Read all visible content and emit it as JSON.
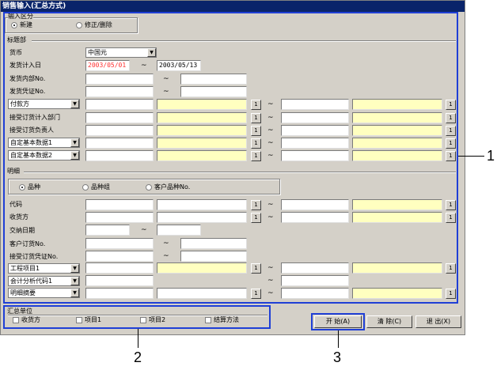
{
  "window": {
    "title": "销售输入(汇总方式)"
  },
  "input_type": {
    "legend": "输入区分",
    "options": [
      {
        "label": "新建",
        "selected": true
      },
      {
        "label": "修正/删除",
        "selected": false
      }
    ]
  },
  "header": {
    "legend": "标题部",
    "currency_label": "货币",
    "currency_value": "中国元",
    "ship_date_label": "发货计入日",
    "ship_date_from": "2003/05/01",
    "ship_date_to": "2003/05/13",
    "ship_internal_label": "发货内部No.",
    "ship_voucher_label": "发货凭证No.",
    "payer_select": "付款方",
    "dept_label": "接受订货计入部门",
    "person_label": "接受订货负责人",
    "custom1_select": "自定基本数据1",
    "custom2_select": "自定基本数据2"
  },
  "detail": {
    "legend": "明细",
    "options": [
      {
        "label": "品种",
        "selected": true
      },
      {
        "label": "品种组",
        "selected": false
      },
      {
        "label": "客户品种No.",
        "selected": false
      }
    ],
    "code_label": "代码",
    "receiver_label": "收货方",
    "delivery_label": "交纳日期",
    "cust_order_label": "客户订货No.",
    "order_voucher_label": "接受订货凭证No.",
    "project_select": "工程项目1",
    "analysis_select": "会计分析代码1",
    "summary_select": "明细摘要"
  },
  "summary_unit": {
    "legend": "汇总单位",
    "options": [
      "收货方",
      "项目1",
      "项目2",
      "结算方法"
    ]
  },
  "buttons": {
    "start": "开 始(A)",
    "clear": "清 除(C)",
    "exit": "退 出(X)"
  },
  "lookup_glyph": "1",
  "range_glyph": "~",
  "callouts": [
    "1",
    "2",
    "3"
  ]
}
